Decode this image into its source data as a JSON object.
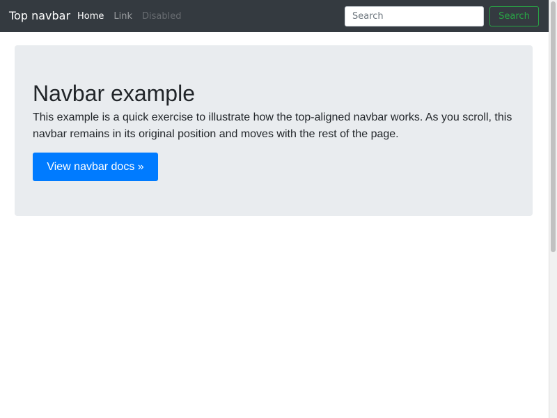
{
  "navbar": {
    "brand": "Top navbar",
    "links": [
      {
        "label": "Home",
        "state": "active"
      },
      {
        "label": "Link",
        "state": "normal"
      },
      {
        "label": "Disabled",
        "state": "disabled"
      }
    ],
    "search": {
      "placeholder": "Search",
      "value": "",
      "button_label": "Search"
    }
  },
  "jumbotron": {
    "title": "Navbar example",
    "lead": "This example is a quick exercise to illustrate how the top-aligned navbar works. As you scroll, this navbar remains in its original position and moves with the rest of the page.",
    "button_label": "View navbar docs »"
  },
  "colors": {
    "navbar_bg": "#343a40",
    "primary": "#007bff",
    "success": "#28a745",
    "jumbotron_bg": "#e9ecef"
  }
}
